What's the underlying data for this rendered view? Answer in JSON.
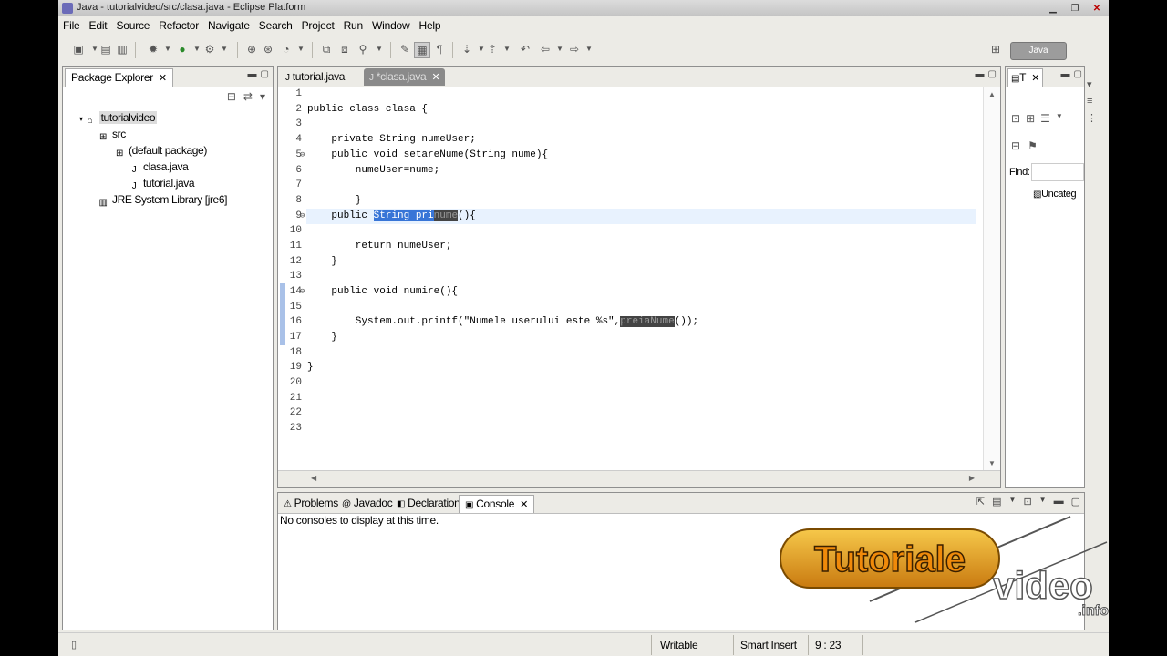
{
  "window": {
    "title": "Java - tutorialvideo/src/clasa.java - Eclipse Platform"
  },
  "menu": [
    "File",
    "Edit",
    "Source",
    "Refactor",
    "Navigate",
    "Search",
    "Project",
    "Run",
    "Window",
    "Help"
  ],
  "perspective": {
    "label": "Java"
  },
  "package_explorer": {
    "tab": "Package Explorer",
    "tree": [
      {
        "label": "tutorialvideo",
        "icon": "project-icon"
      },
      {
        "label": "src",
        "icon": "source-folder-icon"
      },
      {
        "label": "(default package)",
        "icon": "package-icon"
      },
      {
        "label": "clasa.java",
        "icon": "java-file-icon"
      },
      {
        "label": "tutorial.java",
        "icon": "java-file-icon"
      },
      {
        "label": "JRE System Library [jre6]",
        "icon": "library-icon"
      }
    ]
  },
  "editor": {
    "tabs": [
      {
        "label": "tutorial.java"
      },
      {
        "label": "*clasa.java"
      }
    ],
    "lines": [
      {
        "n": "1",
        "code": ""
      },
      {
        "n": "2",
        "code": "public class clasa {"
      },
      {
        "n": "3",
        "code": ""
      },
      {
        "n": "4",
        "code": "    private String numeUser;"
      },
      {
        "n": "5",
        "code": "    public void setareNume(String nume){"
      },
      {
        "n": "6",
        "code": "        numeUser=nume;"
      },
      {
        "n": "7",
        "code": ""
      },
      {
        "n": "8",
        "code": "        }"
      },
      {
        "n": "9",
        "code_pre": "    public ",
        "code_sel": "String pri",
        "code_dark": "nume",
        "code_post": "(){"
      },
      {
        "n": "10",
        "code": ""
      },
      {
        "n": "11",
        "code": "        return numeUser;"
      },
      {
        "n": "12",
        "code": "    }"
      },
      {
        "n": "13",
        "code": ""
      },
      {
        "n": "14",
        "code": "    public void numire(){"
      },
      {
        "n": "15",
        "code": ""
      },
      {
        "n": "16",
        "code_pre": "        System.out.printf(\"Numele userului este %s\",",
        "code_dark": "preiaNume",
        "code_post": "());"
      },
      {
        "n": "17",
        "code": "    }"
      },
      {
        "n": "18",
        "code": ""
      },
      {
        "n": "19",
        "code": "}"
      },
      {
        "n": "20",
        "code": ""
      },
      {
        "n": "21",
        "code": ""
      },
      {
        "n": "22",
        "code": ""
      },
      {
        "n": "23",
        "code": ""
      }
    ]
  },
  "outline": {
    "tab": "T",
    "find_label": "Find:",
    "uncategorized": "Uncateg"
  },
  "bottom_panel": {
    "tabs": [
      {
        "label": "Problems",
        "icon": "problems-icon"
      },
      {
        "label": "Javadoc",
        "icon": "javadoc-icon"
      },
      {
        "label": "Declaration",
        "icon": "declaration-icon"
      },
      {
        "label": "Console",
        "icon": "console-icon"
      }
    ],
    "console_message": "No consoles to display at this time."
  },
  "status_bar": {
    "writable": "Writable",
    "insert_mode": "Smart Insert",
    "position": "9 : 23"
  },
  "watermark": {
    "line1": "Tutoriale",
    "line2": "video",
    "line3": ".info"
  }
}
